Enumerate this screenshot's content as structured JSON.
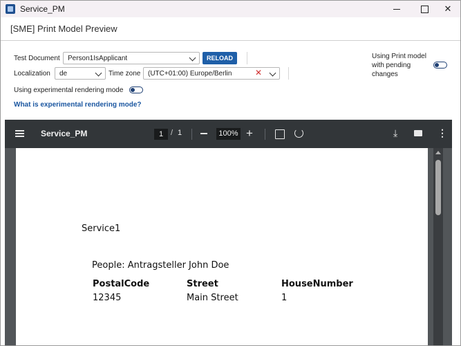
{
  "window": {
    "title": "Service_PM"
  },
  "header": {
    "title": "[SME] Print Model Preview"
  },
  "form": {
    "test_document_label": "Test Document",
    "test_document_value": "Person1IsApplicant",
    "reload_label": "RELOAD",
    "localization_label": "Localization",
    "localization_value": "de",
    "timezone_label": "Time zone",
    "timezone_value": "(UTC+01:00) Europe/Berlin",
    "experimental_label": "Using experimental rendering mode",
    "experimental_enabled": false,
    "experimental_link": "What is experimental rendering mode?",
    "pending_label": "Using Print model with pending changes",
    "pending_enabled": false
  },
  "pdf": {
    "title": "Service_PM",
    "current_page": "1",
    "page_separator": "/",
    "total_pages": "1",
    "zoom": "100%",
    "icons": [
      "menu-icon",
      "zoom-out-icon",
      "zoom-in-icon",
      "fit-page-icon",
      "rotate-icon",
      "download-icon",
      "print-icon",
      "more-icon"
    ]
  },
  "document": {
    "service_title": "Service1",
    "people_line": "People: Antragsteller John Doe",
    "columns": [
      "PostalCode",
      "Street",
      "HouseNumber"
    ],
    "rows": [
      [
        "12345",
        "Main Street",
        "1"
      ]
    ]
  },
  "colors": {
    "accent": "#1f5fa8",
    "pdf_toolbar": "#323639",
    "pdf_background": "#525659",
    "clear_icon": "#d03030"
  }
}
